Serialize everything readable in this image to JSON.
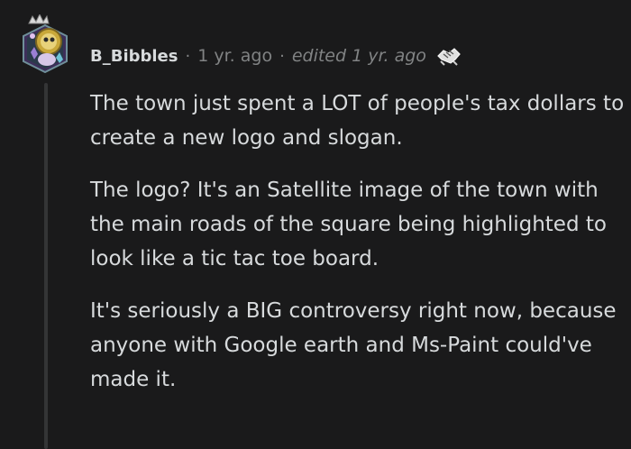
{
  "comment": {
    "author": "B_Bibbles",
    "separator": "·",
    "timestamp": "1 yr. ago",
    "edited": "edited 1 yr. ago",
    "award_icon": "handshake-award-icon",
    "avatar_icon": "snoo-avatar-icon",
    "paragraphs": [
      "The town just spent a LOT of people's tax dollars to create a new logo and slogan.",
      "The logo? It's an Satellite image of the town with the main roads of the square being highlighted to look like a tic tac toe board.",
      "It's seriously a BIG controversy right now, because anyone with Google earth and Ms-Paint could've made it."
    ]
  },
  "colors": {
    "background": "#1a1a1b",
    "text": "#d7dadc",
    "muted": "#818384",
    "thread_line": "#343536"
  }
}
